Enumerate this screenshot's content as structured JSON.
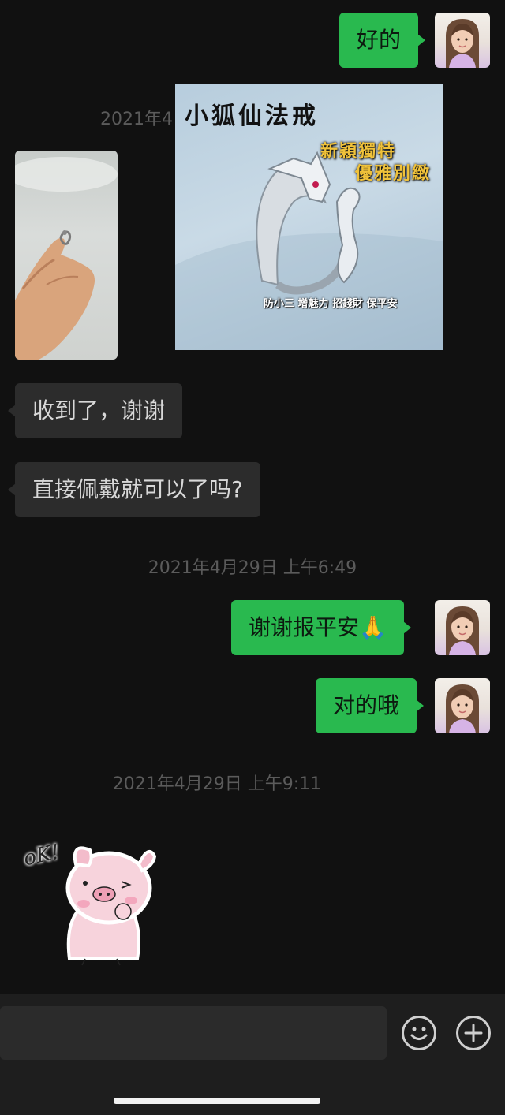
{
  "messages": {
    "m1_text": "好的",
    "m2_text": "收到了，谢谢",
    "m3_text": "直接佩戴就可以了吗?",
    "m4_text": "谢谢报平安",
    "m4_emoji": "🙏",
    "m5_text": "对的哦"
  },
  "timestamps": {
    "t1": "2021年4",
    "t2": "2021年4月29日 上午6:49",
    "t3": "2021年4月29日 上午9:11"
  },
  "product_card": {
    "title": "小狐仙法戒",
    "tagline_line1": "新穎獨特",
    "tagline_line2": "優雅別緻",
    "footer": "防小三 增魅力 招錢財 保平安"
  },
  "sticker": {
    "ok_text": "oK!"
  },
  "colors": {
    "outgoing_bubble": "#29b94f",
    "incoming_bubble": "#2c2c2c",
    "background": "#111111"
  },
  "icons": {
    "emoji_button": "smiley-icon",
    "more_button": "plus-icon"
  }
}
